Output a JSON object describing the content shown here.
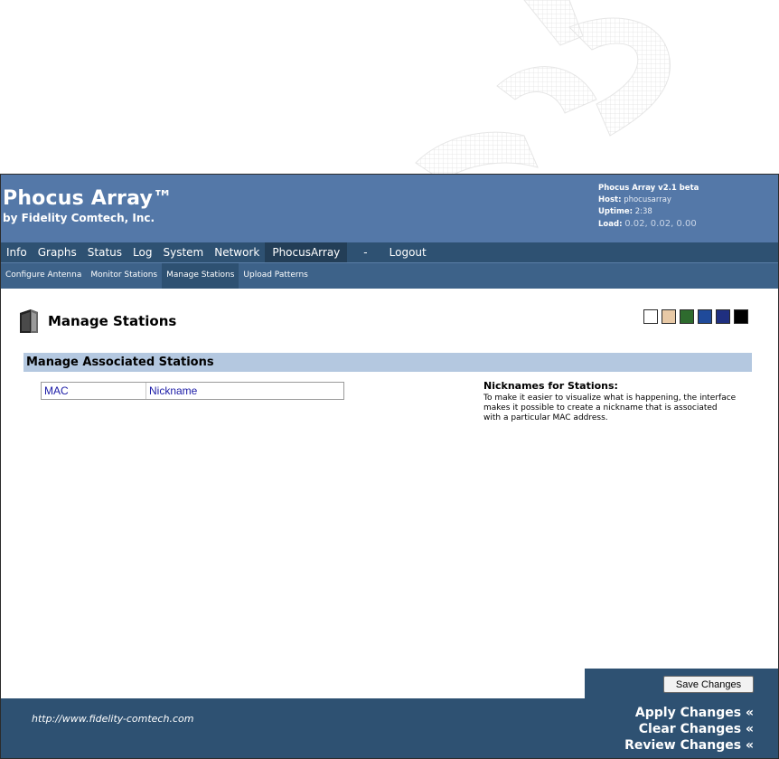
{
  "header": {
    "title": "Phocus Array™",
    "subtitle": "by Fidelity Comtech, Inc.",
    "version": "Phocus Array v2.1 beta",
    "host_label": "Host:",
    "host_value": "phocusarray",
    "uptime_label": "Uptime:",
    "uptime_value": "2:38",
    "load_label": "Load:",
    "load_value": "0.02, 0.02, 0.00"
  },
  "main_nav": {
    "items": [
      {
        "label": "Info"
      },
      {
        "label": "Graphs"
      },
      {
        "label": "Status"
      },
      {
        "label": "Log"
      },
      {
        "label": "System"
      },
      {
        "label": "Network"
      },
      {
        "label": "PhocusArray"
      },
      {
        "label": "-"
      },
      {
        "label": "Logout"
      }
    ],
    "active": "PhocusArray"
  },
  "sub_nav": {
    "items": [
      {
        "label": "Configure Antenna"
      },
      {
        "label": "Monitor Stations"
      },
      {
        "label": "Manage Stations"
      },
      {
        "label": "Upload Patterns"
      }
    ],
    "active": "Manage Stations"
  },
  "page": {
    "title": "Manage Stations",
    "icon": "device-icon",
    "section_title": "Manage Associated Stations",
    "table": {
      "columns": [
        "MAC",
        "Nickname"
      ],
      "rows": []
    },
    "help": {
      "title": "Nicknames for Stations:",
      "body": "To make it easier to visualize what is happening, the interface makes it possible to create a nickname that is associated with a particular MAC address."
    }
  },
  "theme_swatches": [
    "#ffffff",
    "#e8c9a6",
    "#2e6b2e",
    "#1f4a9a",
    "#1f2f80",
    "#000000"
  ],
  "save_button_label": "Save Changes",
  "footer": {
    "url": "http://www.fidelity-comtech.com",
    "apply": "Apply Changes «",
    "clear": "Clear Changes «",
    "review": "Review Changes «"
  },
  "colors": {
    "header_bg": "#5478a8",
    "nav_bg": "#2e5172",
    "subnav_bg": "#3d6289",
    "section_bg": "#b4c8e0"
  }
}
